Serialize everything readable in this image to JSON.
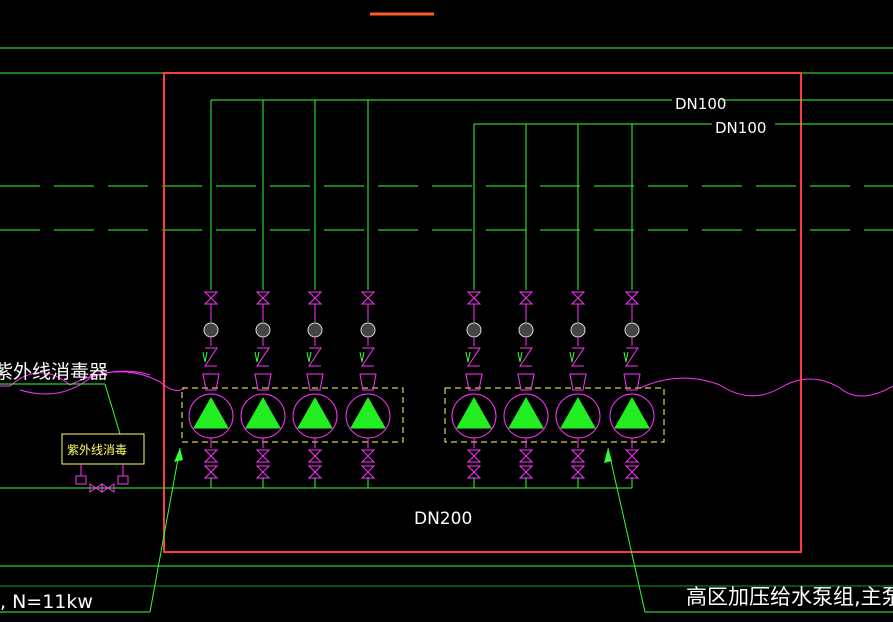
{
  "labels": {
    "dn100_a": "DN100",
    "dn100_b": "DN100",
    "dn200": "DN200",
    "uv_sterilizer_left": "紫外线消毒器",
    "uv_sterilizer_box": "紫外线消毒",
    "motor_power": ", N=11kw",
    "pump_group_note": "高区加压给水泵组,主泵两用"
  },
  "colors": {
    "background": "#000000",
    "pipe_green": "#33ff33",
    "valve_magenta": "#ff33ff",
    "pump_fill": "#22ee22",
    "frame_red": "#ff3b3b",
    "yellow_dash": "#ffff66",
    "white_text": "#ffffff",
    "orange_mark": "#ff5a2a"
  },
  "pump_groups": [
    {
      "name": "left-group",
      "pump_count": 4
    },
    {
      "name": "right-group",
      "pump_count": 4
    }
  ]
}
